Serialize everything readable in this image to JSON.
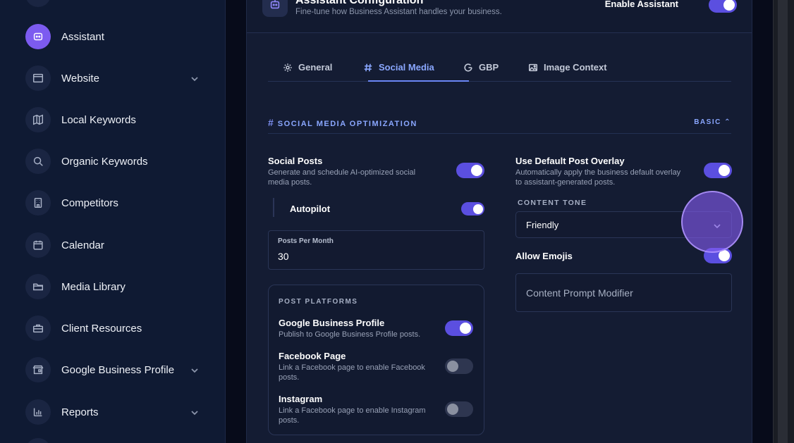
{
  "sidebar": {
    "items": [
      {
        "label": "Assistant",
        "icon": "assistant-icon",
        "active": true,
        "has_chevron": false
      },
      {
        "label": "Website",
        "icon": "browser-window-icon",
        "active": false,
        "has_chevron": true
      },
      {
        "label": "Local Keywords",
        "icon": "map-icon",
        "active": false,
        "has_chevron": false
      },
      {
        "label": "Organic Keywords",
        "icon": "search-icon",
        "active": false,
        "has_chevron": false
      },
      {
        "label": "Competitors",
        "icon": "building-icon",
        "active": false,
        "has_chevron": false
      },
      {
        "label": "Calendar",
        "icon": "calendar-icon",
        "active": false,
        "has_chevron": false
      },
      {
        "label": "Media Library",
        "icon": "folder-icon",
        "active": false,
        "has_chevron": false
      },
      {
        "label": "Client Resources",
        "icon": "briefcase-icon",
        "active": false,
        "has_chevron": false
      },
      {
        "label": "Google Business Profile",
        "icon": "storefront-icon",
        "active": false,
        "has_chevron": true
      },
      {
        "label": "Reports",
        "icon": "bar-chart-icon",
        "active": false,
        "has_chevron": true
      }
    ]
  },
  "header": {
    "title": "Assistant Configuration",
    "subtitle": "Fine-tune how Business Assistant handles your business.",
    "enable_label": "Enable Assistant",
    "enabled": true
  },
  "tabs": [
    {
      "label": "General",
      "icon": "gear-icon",
      "active": false
    },
    {
      "label": "Social Media",
      "icon": "hash-icon",
      "active": true
    },
    {
      "label": "GBP",
      "icon": "google-g-icon",
      "active": false
    },
    {
      "label": "Image Context",
      "icon": "image-icon",
      "active": false
    }
  ],
  "section": {
    "title": "SOCIAL MEDIA OPTIMIZATION",
    "mode": "BASIC"
  },
  "social_posts": {
    "label": "Social Posts",
    "description_line1": "Generate and schedule AI-optimized social",
    "description_line2": "media posts.",
    "enabled": true
  },
  "autopilot": {
    "label": "Autopilot",
    "enabled": true
  },
  "posts_per_month": {
    "label": "Posts Per Month",
    "value": "30"
  },
  "platforms": {
    "heading": "POST PLATFORMS",
    "items": [
      {
        "label": "Google Business Profile",
        "desc1": "Publish to Google Business Profile posts.",
        "desc2": "",
        "enabled": true
      },
      {
        "label": "Facebook Page",
        "desc1": "Link a Facebook page to enable Facebook",
        "desc2": "posts.",
        "enabled": false
      },
      {
        "label": "Instagram",
        "desc1": "Link a Facebook page to enable Instagram",
        "desc2": "posts.",
        "enabled": false
      }
    ]
  },
  "overlay": {
    "label": "Use Default Post Overlay",
    "description_line1": "Automatically apply the business default overlay",
    "description_line2": "to assistant-generated posts.",
    "enabled": true
  },
  "content_tone": {
    "label": "CONTENT TONE",
    "value": "Friendly"
  },
  "emojis": {
    "label": "Allow Emojis",
    "enabled": true
  },
  "prompt_modifier": {
    "placeholder": "Content Prompt Modifier"
  },
  "colors": {
    "accent": "#5b4fe0",
    "active_tab": "#8aa7ff",
    "sidebar_bg": "#0f1a33",
    "panel_bg": "#141c33"
  }
}
